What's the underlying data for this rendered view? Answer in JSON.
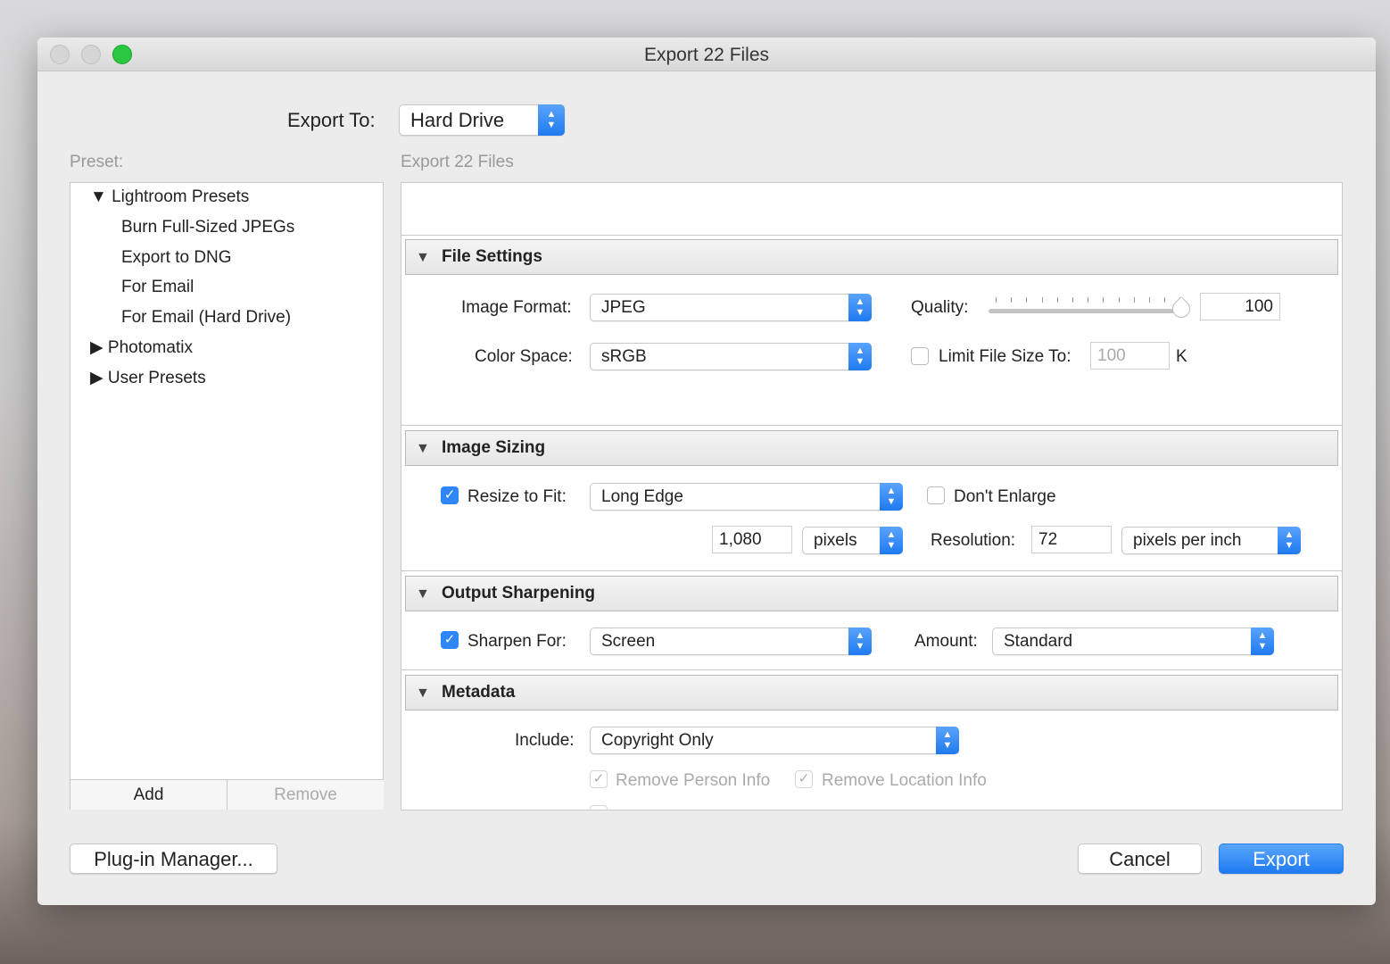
{
  "window": {
    "title": "Export 22 Files"
  },
  "export_to": {
    "label": "Export To:",
    "value": "Hard Drive"
  },
  "preset": {
    "label": "Preset:",
    "tree": [
      {
        "label": "Lightroom Presets",
        "expanded": true,
        "children": [
          "Burn Full-Sized JPEGs",
          "Export to DNG",
          "For Email",
          "For Email (Hard Drive)"
        ]
      },
      {
        "label": "Photomatix",
        "expanded": false
      },
      {
        "label": "User Presets",
        "expanded": false
      }
    ],
    "add": "Add",
    "remove": "Remove"
  },
  "main": {
    "heading": "Export 22 Files"
  },
  "file_settings": {
    "title": "File Settings",
    "image_format_label": "Image Format:",
    "image_format": "JPEG",
    "quality_label": "Quality:",
    "quality": "100",
    "color_space_label": "Color Space:",
    "color_space": "sRGB",
    "limit_label": "Limit File Size To:",
    "limit_checked": false,
    "limit_value": "100",
    "limit_unit": "K"
  },
  "image_sizing": {
    "title": "Image Sizing",
    "resize_label": "Resize to Fit:",
    "resize_checked": true,
    "resize_mode": "Long Edge",
    "dont_enlarge": "Don't Enlarge",
    "dont_enlarge_checked": false,
    "size": "1,080",
    "size_unit": "pixels",
    "resolution_label": "Resolution:",
    "resolution": "72",
    "resolution_unit": "pixels per inch"
  },
  "output_sharpening": {
    "title": "Output Sharpening",
    "sharpen_label": "Sharpen For:",
    "sharpen_checked": true,
    "sharpen_for": "Screen",
    "amount_label": "Amount:",
    "amount": "Standard"
  },
  "metadata": {
    "title": "Metadata",
    "include_label": "Include:",
    "include": "Copyright Only",
    "remove_person": "Remove Person Info",
    "remove_location": "Remove Location Info"
  },
  "footer": {
    "plugin_manager": "Plug-in Manager...",
    "cancel": "Cancel",
    "export": "Export"
  },
  "colors": {
    "accent": "#2f86f6"
  }
}
